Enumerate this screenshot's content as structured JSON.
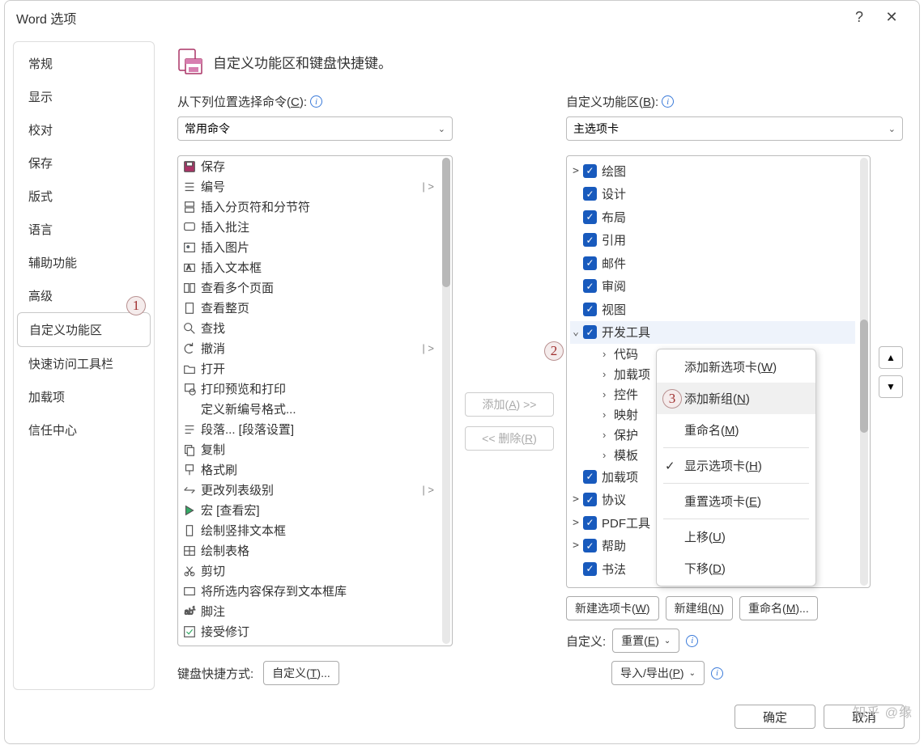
{
  "title": "Word 选项",
  "header": "自定义功能区和键盘快捷键。",
  "sidebar": [
    "常规",
    "显示",
    "校对",
    "保存",
    "版式",
    "语言",
    "辅助功能",
    "高级",
    "自定义功能区",
    "快速访问工具栏",
    "加载项",
    "信任中心"
  ],
  "selected_sidebar_index": 8,
  "left": {
    "label": "从下列位置选择命令(C):",
    "combo": "常用命令",
    "commands": [
      {
        "t": "保存",
        "ico": "save",
        "sub": ""
      },
      {
        "t": "编号",
        "ico": "list",
        "sub": "| >"
      },
      {
        "t": "插入分页符和分节符",
        "ico": "pagebreak",
        "sub": ""
      },
      {
        "t": "插入批注",
        "ico": "comment",
        "sub": ""
      },
      {
        "t": "插入图片",
        "ico": "picture",
        "sub": ""
      },
      {
        "t": "插入文本框",
        "ico": "textbox",
        "sub": ""
      },
      {
        "t": "查看多个页面",
        "ico": "multipage",
        "sub": ""
      },
      {
        "t": "查看整页",
        "ico": "page",
        "sub": ""
      },
      {
        "t": "查找",
        "ico": "find",
        "sub": ""
      },
      {
        "t": "撤消",
        "ico": "undo",
        "sub": "| >"
      },
      {
        "t": "打开",
        "ico": "open",
        "sub": ""
      },
      {
        "t": "打印预览和打印",
        "ico": "printpreview",
        "sub": ""
      },
      {
        "t": "定义新编号格式...",
        "ico": "",
        "sub": ""
      },
      {
        "t": "段落... [段落设置]",
        "ico": "para",
        "sub": ""
      },
      {
        "t": "复制",
        "ico": "copy",
        "sub": ""
      },
      {
        "t": "格式刷",
        "ico": "paint",
        "sub": ""
      },
      {
        "t": "更改列表级别",
        "ico": "listlevel",
        "sub": "| >"
      },
      {
        "t": "宏 [查看宏]",
        "ico": "macro",
        "sub": ""
      },
      {
        "t": "绘制竖排文本框",
        "ico": "vtextbox",
        "sub": ""
      },
      {
        "t": "绘制表格",
        "ico": "drawtable",
        "sub": ""
      },
      {
        "t": "剪切",
        "ico": "cut",
        "sub": ""
      },
      {
        "t": "将所选内容保存到文本框库",
        "ico": "savebox",
        "sub": ""
      },
      {
        "t": "脚注",
        "ico": "footnote",
        "sub": ""
      },
      {
        "t": "接受修订",
        "ico": "accept",
        "sub": ""
      }
    ]
  },
  "mid": {
    "add": "添加(A) >>",
    "remove": "<< 删除(R)"
  },
  "right": {
    "label": "自定义功能区(B):",
    "combo": "主选项卡",
    "tabs": [
      {
        "t": "绘图",
        "exp": ">"
      },
      {
        "t": "设计",
        "exp": ""
      },
      {
        "t": "布局",
        "exp": ""
      },
      {
        "t": "引用",
        "exp": ""
      },
      {
        "t": "邮件",
        "exp": ""
      },
      {
        "t": "审阅",
        "exp": ""
      },
      {
        "t": "视图",
        "exp": ""
      }
    ],
    "dev_tab": "开发工具",
    "dev_children": [
      "代码",
      "加载项",
      "控件",
      "映射",
      "保护",
      "模板"
    ],
    "tail": [
      {
        "t": "加载项",
        "exp": ""
      },
      {
        "t": "协议",
        "exp": ">"
      },
      {
        "t": "PDF工具",
        "exp": ">"
      },
      {
        "t": "帮助",
        "exp": ">"
      },
      {
        "t": "书法",
        "exp": ""
      }
    ],
    "btns": {
      "newtab": "新建选项卡(W)",
      "newgroup": "新建组(N)",
      "rename": "重命名(M)..."
    },
    "customize_label": "自定义:",
    "reset": "重置(E)",
    "importexport": "导入/导出(P)"
  },
  "kbd": {
    "label": "键盘快捷方式:",
    "btn": "自定义(T)..."
  },
  "context": [
    {
      "t": "添加新选项卡(W)"
    },
    {
      "t": "添加新组(N)",
      "hl": true
    },
    {
      "t": "重命名(M)"
    },
    {
      "sep": true
    },
    {
      "t": "显示选项卡(H)",
      "check": true
    },
    {
      "sep": true
    },
    {
      "t": "重置选项卡(E)"
    },
    {
      "sep": true
    },
    {
      "t": "上移(U)"
    },
    {
      "t": "下移(D)"
    }
  ],
  "badges": {
    "1": "1",
    "2": "2",
    "3": "3"
  },
  "footer": {
    "ok": "确定",
    "cancel": "取消"
  },
  "watermark": "知乎 @缘"
}
